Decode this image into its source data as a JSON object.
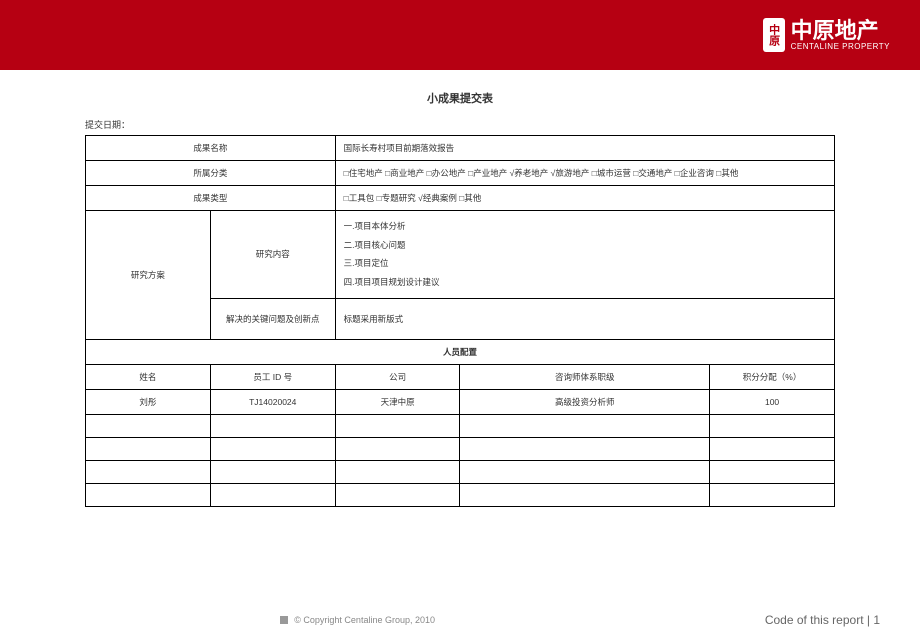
{
  "header": {
    "logo_badge": "中原",
    "logo_cn": "中原地产",
    "logo_en": "CENTALINE PROPERTY"
  },
  "title": "小成果提交表",
  "submit_date_label": "提交日期：",
  "rows": {
    "name_label": "成果名称",
    "name_value": "国际长寿村项目前期落效报告",
    "category_label": "所属分类",
    "category_value": "□住宅地产 □商业地产 □办公地产 □产业地产 √养老地产 √旅游地产 □城市运营 □交通地产 □企业咨询 □其他",
    "type_label": "成果类型",
    "type_value": "□工具包 □专题研究 √经典案例 □其他",
    "scheme_label": "研究方案",
    "research_label": "研究内容",
    "research_1": "一.项目本体分析",
    "research_2": "二.项目核心问题",
    "research_3": "三.项目定位",
    "research_4": "四.项目项目规划设计建议",
    "innovate_label": "解决的关键问题及创新点",
    "innovate_value": "标题采用新版式"
  },
  "personnel": {
    "heading": "人员配置",
    "h_name": "姓名",
    "h_id": "员工 ID 号",
    "h_company": "公司",
    "h_level": "咨询师体系职级",
    "h_score": "积分分配（%）",
    "r1_name": "刘彤",
    "r1_id": "TJ14020024",
    "r1_company": "天津中原",
    "r1_level": "高级投资分析师",
    "r1_score": "100"
  },
  "footer": {
    "copyright": "© Copyright  Centaline Group, 2010",
    "page": "Code of this report   |   1"
  }
}
